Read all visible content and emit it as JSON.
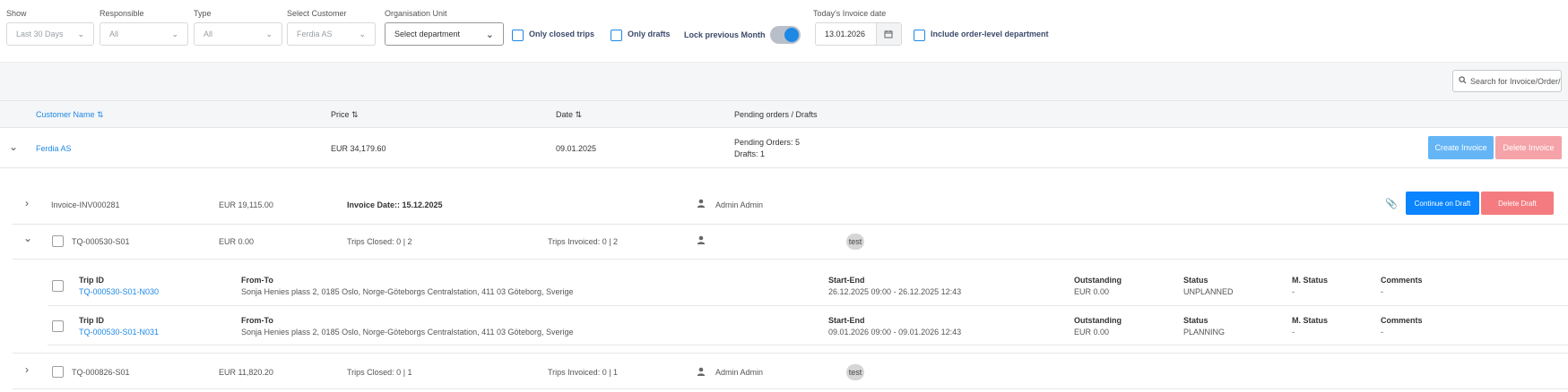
{
  "filters": {
    "show": {
      "label": "Show",
      "value": "Last 30 Days"
    },
    "responsible": {
      "label": "Responsible",
      "value": "All"
    },
    "type": {
      "label": "Type",
      "value": "All"
    },
    "customer": {
      "label": "Select Customer",
      "value": "Ferdia AS"
    },
    "org_unit": {
      "label": "Organisation Unit",
      "value": "Select department"
    },
    "only_closed_trips": "Only closed trips",
    "only_drafts": "Only drafts",
    "lock_previous_month": "Lock previous Month",
    "invoice_date": {
      "label": "Today's Invoice date",
      "value": "13.01.2026"
    },
    "include_order_level": "Include order-level department"
  },
  "search": {
    "placeholder": "Search for Invoice/Order/"
  },
  "table": {
    "headers": {
      "customer_name": "Customer Name",
      "price": "Price",
      "date": "Date",
      "pending": "Pending orders / Drafts"
    },
    "customer_row": {
      "name": "Ferdia AS",
      "price": "EUR  34,179.60",
      "date": "09.01.2025",
      "pending_orders": "Pending Orders: 5",
      "drafts": "Drafts: 1",
      "create_invoice": "Create Invoice",
      "delete_invoice": "Delete Invoice"
    },
    "invoice_row": {
      "id": "Invoice-INV000281",
      "price": "EUR  19,115.00",
      "invoice_date": "Invoice Date:: 15.12.2025",
      "user": "Admin Admin",
      "continue_draft": "Continue on Draft",
      "delete_draft": "Delete Draft"
    },
    "order_rows": [
      {
        "id": "TQ-000530-S01",
        "price": "EUR  0.00",
        "trips_closed": "Trips Closed: 0 | 2",
        "trips_invoiced": "Trips Invoiced: 0 | 2",
        "user": "",
        "tag": "test"
      },
      {
        "id": "TQ-000826-S01",
        "price": "EUR  11,820.20",
        "trips_closed": "Trips Closed: 0 | 1",
        "trips_invoiced": "Trips Invoiced: 0 | 1",
        "user": "Admin Admin",
        "tag": "test"
      }
    ],
    "trip_labels": {
      "trip_id": "Trip ID",
      "from_to": "From-To",
      "start_end": "Start-End",
      "outstanding": "Outstanding",
      "status": "Status",
      "m_status": "M. Status",
      "comments": "Comments"
    },
    "trips": [
      {
        "trip_id": "TQ-000530-S01-N030",
        "from_to": "Sonja Henies plass 2, 0185 Oslo, Norge-Göteborgs Centralstation, 411 03 Göteborg, Sverige",
        "start_end": "26.12.2025 09:00 - 26.12.2025 12:43",
        "outstanding": "EUR  0.00",
        "status": "UNPLANNED",
        "m_status": "-",
        "comments": "-"
      },
      {
        "trip_id": "TQ-000530-S01-N031",
        "from_to": "Sonja Henies plass 2, 0185 Oslo, Norge-Göteborgs Centralstation, 411 03 Göteborg, Sverige",
        "start_end": "09.01.2026 09:00 - 09.01.2026 12:43",
        "outstanding": "EUR  0.00",
        "status": "PLANNING",
        "m_status": "-",
        "comments": "-"
      }
    ]
  },
  "colors": {
    "primary": "#1e88e5",
    "create_invoice": "#64b5f6",
    "delete_invoice": "#f5a3a8",
    "continue_draft": "#0a84ff",
    "delete_draft": "#f47c80"
  },
  "icons": [
    "chevron-down-icon",
    "calendar-icon",
    "search-icon",
    "sort-icon",
    "chevron-right-icon",
    "user-icon",
    "paperclip-icon"
  ]
}
